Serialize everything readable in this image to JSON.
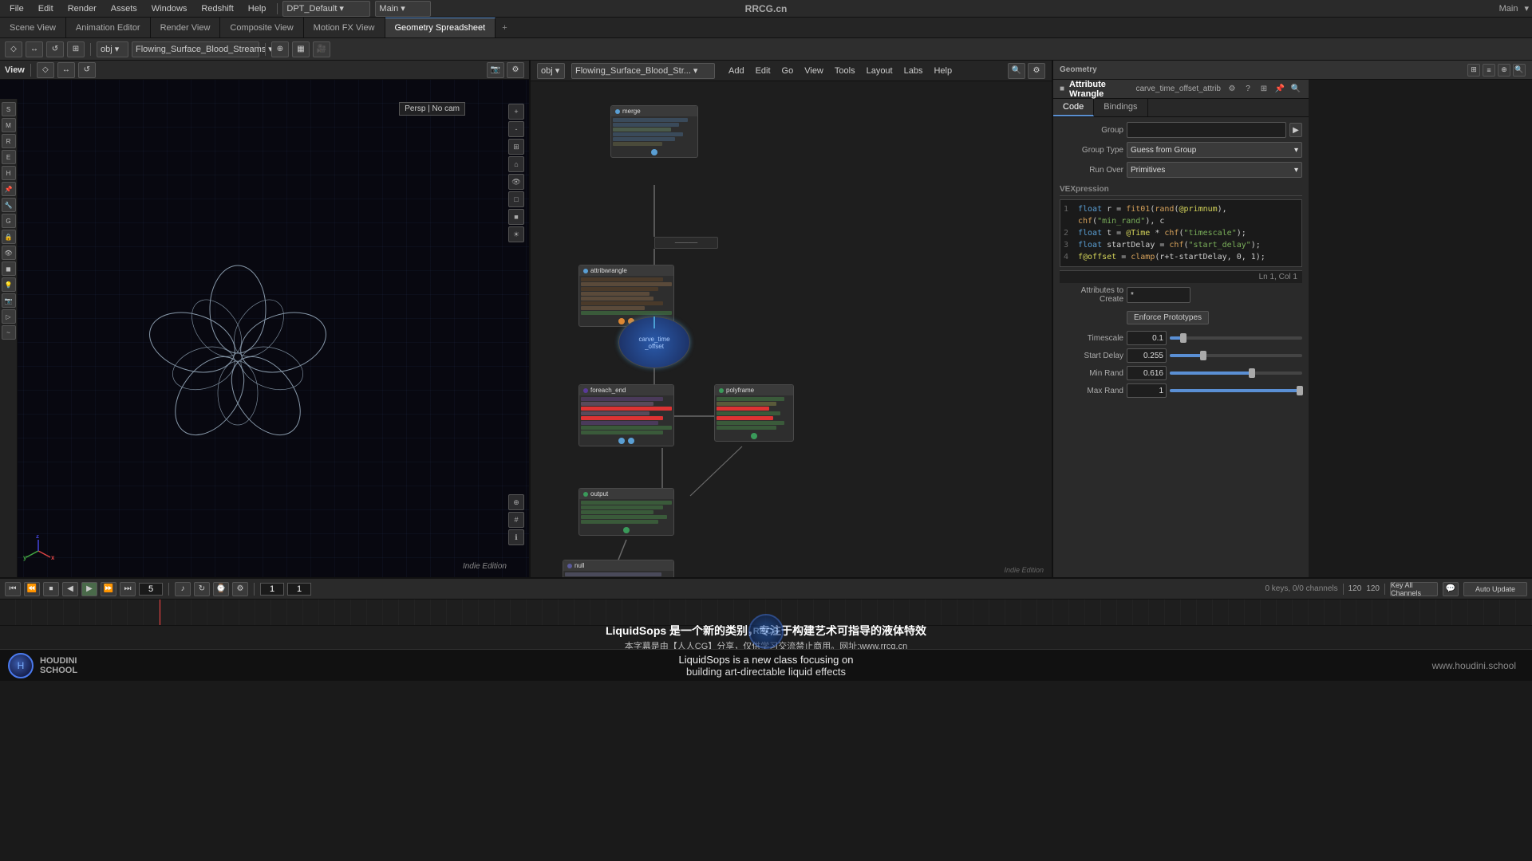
{
  "app": {
    "title": "RRCG.cn",
    "workspace": "Main",
    "workspace2": "Main",
    "project": "DPT_Default"
  },
  "menu": {
    "items": [
      "File",
      "Edit",
      "Render",
      "Assets",
      "Windows",
      "Redshift",
      "Help"
    ]
  },
  "top_tabs": [
    {
      "label": "Scene View",
      "active": false
    },
    {
      "label": "Animation Editor",
      "active": false
    },
    {
      "label": "Render View",
      "active": false
    },
    {
      "label": "Composite View",
      "active": false
    },
    {
      "label": "Motion FX View",
      "active": false
    },
    {
      "label": "Geometry Spreadsheet",
      "active": true
    }
  ],
  "viewport": {
    "label": "View",
    "persp": "Persp",
    "cam": "No cam",
    "indie_badge": "Indie Edition"
  },
  "node_editor": {
    "path": "obj/Flowing_Surface_Blood_Str...",
    "menus": [
      "Add",
      "Edit",
      "Go",
      "View",
      "Tools",
      "Layout",
      "Labs",
      "Help"
    ]
  },
  "attrib_wrangle": {
    "title": "Attribute Wrangle",
    "node_name": "carve_time_offset_attrib",
    "tabs": [
      "Code",
      "Bindings"
    ],
    "active_tab": "Code",
    "group_label": "Group",
    "group_value": "",
    "group_type_label": "Group Type",
    "group_type_value": "Guess from Group",
    "run_over_label": "Run Over",
    "run_over_value": "Primitives",
    "vex_label": "VEXpression",
    "vex_lines": [
      {
        "num": 1,
        "code": "float r = fit01(rand(@primnum), chf(\"min_rand\"), c"
      },
      {
        "num": 2,
        "code": "float t = @Time * chf(\"timescale\");"
      },
      {
        "num": 3,
        "code": "float startDelay = chf(\"start_delay\");"
      },
      {
        "num": 4,
        "code": "f@offset = clamp(r+t-startDelay, 0, 1);"
      }
    ],
    "vex_status": "Ln 1, Col 1",
    "attrs_to_create_label": "Attributes to Create",
    "attrs_to_create_value": "*",
    "enforce_btn": "Enforce Prototypes",
    "params": [
      {
        "label": "Timescale",
        "value": "0.1",
        "pct": 10
      },
      {
        "label": "Start Delay",
        "value": "0.255",
        "pct": 25
      },
      {
        "label": "Min Rand",
        "value": "0.616",
        "pct": 62
      },
      {
        "label": "Max Rand",
        "value": "1",
        "pct": 100
      }
    ]
  },
  "timeline": {
    "current_frame": "5",
    "frame_display": "5",
    "frame_start": "1",
    "frame_end": "1",
    "total_frames": "120",
    "total_frames2": "120",
    "keys_channels": "0 keys, 0/0 channels",
    "key_all_channels": "Key All Channels",
    "auto_update": "Auto Update"
  },
  "subtitles": {
    "cn1": "LiquidSops 是一个新的类别，专注于构建艺术可指导的液体特效",
    "cn2": "本字幕是由【人人CG】分享，仅供学习交流禁止商用。网址:www.rrcg.cn",
    "en1": "LiquidSops is a new class focusing on",
    "en2": "building art-directable liquid effects"
  },
  "bottom": {
    "houdini_school": "HOUDINI",
    "houdini_sub": "SCHOOL",
    "url": "www.houdini.school",
    "rrcg": "RRCG.cn"
  },
  "colors": {
    "accent_blue": "#5a8fd4",
    "accent_orange": "#d4803a",
    "selected_node": "#4a9fd4",
    "bg_dark": "#1a1a1a",
    "bg_mid": "#2a2a2a",
    "vex_keyword": "#5a9fd4",
    "vex_function": "#d4a05a",
    "vex_string": "#7aaf5a"
  }
}
